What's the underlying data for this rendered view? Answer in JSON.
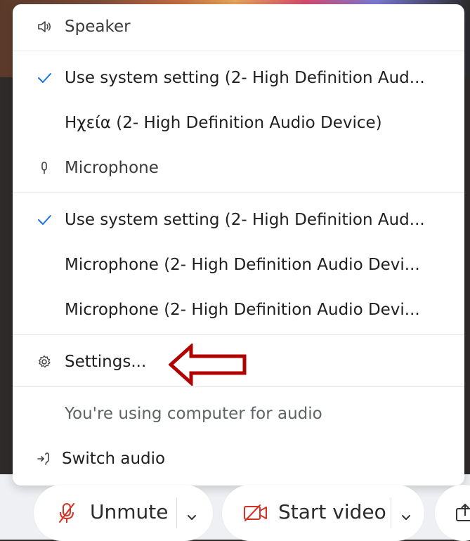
{
  "colors": {
    "check": "#1a73e8",
    "muted_text": "#5f6368",
    "mic_muted_red": "#d93025",
    "arrow_red": "#b00000"
  },
  "menu": {
    "speaker_section": {
      "icon": "speaker-icon",
      "label": "Speaker"
    },
    "speaker_options": [
      {
        "label": "Use system setting (2- High Definition Aud...",
        "selected": true
      },
      {
        "label": "Ηχεία (2- High Definition Audio Device)",
        "selected": false
      }
    ],
    "microphone_section": {
      "icon": "microphone-icon",
      "label": "Microphone"
    },
    "microphone_options": [
      {
        "label": "Use system setting (2- High Definition Aud...",
        "selected": true
      },
      {
        "label": "Microphone (2- High Definition Audio Devi...",
        "selected": false
      },
      {
        "label": "Microphone (2- High Definition Audio Devi...",
        "selected": false
      }
    ],
    "settings": {
      "icon": "gear-icon",
      "label": "Settings..."
    },
    "status_text": "You're using computer for audio",
    "switch_audio": {
      "icon": "switch-audio-icon",
      "label": "Switch audio"
    }
  },
  "toolbar": {
    "unmute": {
      "icon": "muted-microphone-icon",
      "label": "Unmute"
    },
    "start_video": {
      "icon": "video-off-icon",
      "label": "Start video"
    },
    "share": {
      "icon": "share-icon"
    }
  }
}
